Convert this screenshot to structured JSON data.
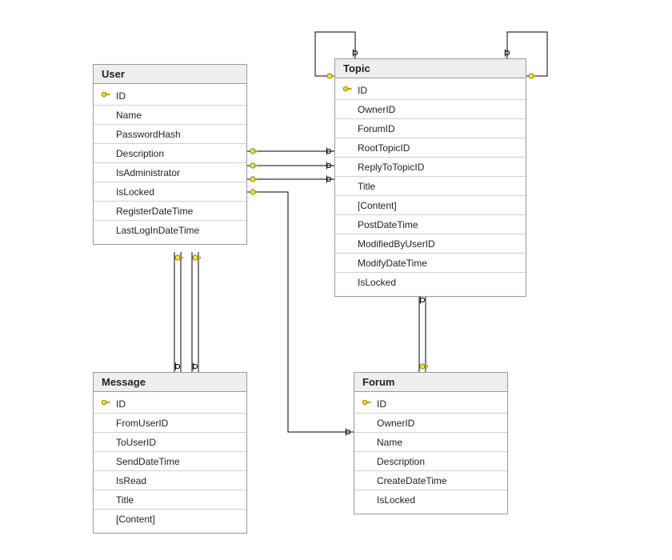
{
  "entities": {
    "user": {
      "title": "User",
      "columns": [
        {
          "name": "ID",
          "pk": true
        },
        {
          "name": "Name",
          "pk": false
        },
        {
          "name": "PasswordHash",
          "pk": false
        },
        {
          "name": "Description",
          "pk": false
        },
        {
          "name": "IsAdministrator",
          "pk": false
        },
        {
          "name": "IsLocked",
          "pk": false
        },
        {
          "name": "RegisterDateTime",
          "pk": false
        },
        {
          "name": "LastLogInDateTime",
          "pk": false
        }
      ]
    },
    "topic": {
      "title": "Topic",
      "columns": [
        {
          "name": "ID",
          "pk": true
        },
        {
          "name": "OwnerID",
          "pk": false
        },
        {
          "name": "ForumID",
          "pk": false
        },
        {
          "name": "RootTopicID",
          "pk": false
        },
        {
          "name": "ReplyToTopicID",
          "pk": false
        },
        {
          "name": "Title",
          "pk": false
        },
        {
          "name": "[Content]",
          "pk": false
        },
        {
          "name": "PostDateTime",
          "pk": false
        },
        {
          "name": "ModifiedByUserID",
          "pk": false
        },
        {
          "name": "ModifyDateTime",
          "pk": false
        },
        {
          "name": "IsLocked",
          "pk": false
        }
      ]
    },
    "message": {
      "title": "Message",
      "columns": [
        {
          "name": "ID",
          "pk": true
        },
        {
          "name": "FromUserID",
          "pk": false
        },
        {
          "name": "ToUserID",
          "pk": false
        },
        {
          "name": "SendDateTime",
          "pk": false
        },
        {
          "name": "IsRead",
          "pk": false
        },
        {
          "name": "Title",
          "pk": false
        },
        {
          "name": "[Content]",
          "pk": false
        }
      ]
    },
    "forum": {
      "title": "Forum",
      "columns": [
        {
          "name": "ID",
          "pk": true
        },
        {
          "name": "OwnerID",
          "pk": false
        },
        {
          "name": "Name",
          "pk": false
        },
        {
          "name": "Description",
          "pk": false
        },
        {
          "name": "CreateDateTime",
          "pk": false
        },
        {
          "name": "IsLocked",
          "pk": false
        }
      ]
    }
  },
  "relationships": [
    {
      "from": "User",
      "to": "Topic",
      "note": "User ⟶ Topic (OwnerID / ModifiedByUserID)"
    },
    {
      "from": "User",
      "to": "Message",
      "note": "User ⟶ Message (FromUserID / ToUserID)"
    },
    {
      "from": "User",
      "to": "Forum",
      "note": "User ⟶ Forum (OwnerID)"
    },
    {
      "from": "Topic",
      "to": "Topic",
      "note": "Topic self-reference (RootTopicID / ReplyToTopicID)"
    },
    {
      "from": "Forum",
      "to": "Topic",
      "note": "Forum ⟶ Topic (ForumID)"
    }
  ],
  "colors": {
    "key": "#caa400",
    "connector": "#000000"
  }
}
